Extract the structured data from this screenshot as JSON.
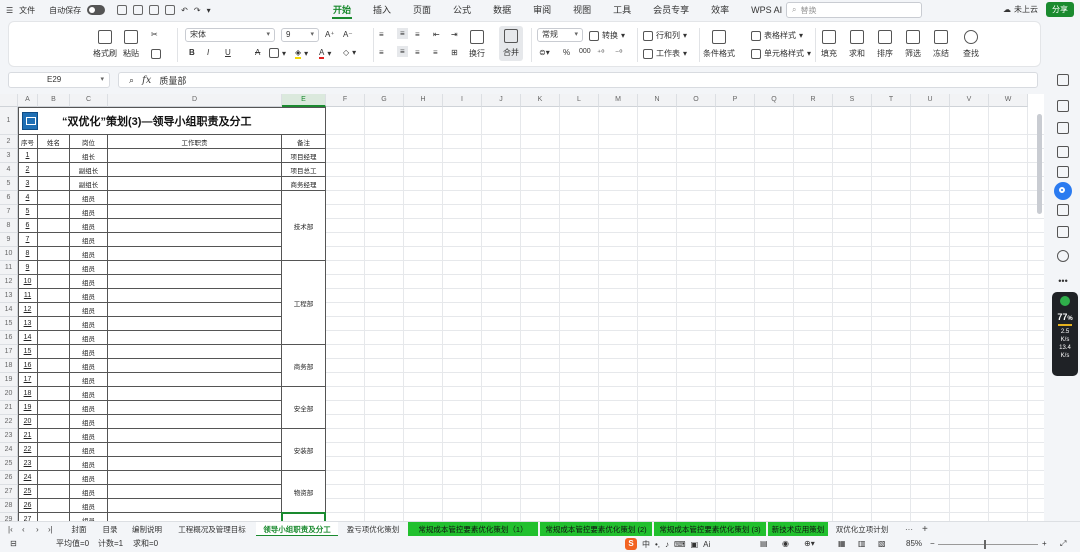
{
  "menubar": {
    "file": "文件",
    "autosave": "自动保存",
    "tabs": [
      "开始",
      "插入",
      "页面",
      "公式",
      "数据",
      "审阅",
      "视图",
      "工具",
      "会员专享",
      "效率",
      "WPS AI"
    ],
    "active_tab": "开始",
    "search_placeholder": "替换",
    "cloud": "未上云",
    "share": "分享"
  },
  "ribbon": {
    "format_painter": "格式刷",
    "paste": "粘贴",
    "font_name": "宋体",
    "font_size": "9",
    "bold": "B",
    "italic": "I",
    "underline": "U",
    "strike": "A",
    "wrap": "换行",
    "merge": "合并",
    "number_format": "常规",
    "convert": "转换",
    "rows_cols": "行和列",
    "worksheet": "工作表",
    "cond_format": "条件格式",
    "table_style": "表格样式",
    "cell_style": "单元格样式",
    "fill": "填充",
    "sum": "求和",
    "sort": "排序",
    "filter": "筛选",
    "freeze": "冻结",
    "find": "查找",
    "percent": "%",
    "thousand": "000"
  },
  "formula_bar": {
    "cell_ref": "E29",
    "fx": "fx",
    "content": "质量部"
  },
  "sheet": {
    "columns": [
      "A",
      "B",
      "C",
      "D",
      "E",
      "F",
      "G",
      "H",
      "I",
      "J",
      "K",
      "L",
      "M",
      "N",
      "O",
      "P",
      "Q",
      "R",
      "S",
      "T",
      "U",
      "V",
      "W"
    ],
    "title": "“双优化”策划(3)—领导小组职责及分工",
    "headers": [
      "序号",
      "姓名",
      "岗位",
      "工作职责",
      "备注"
    ],
    "rows": [
      {
        "r": "3",
        "idx": "1",
        "role": "组长",
        "note": "项目经理"
      },
      {
        "r": "4",
        "idx": "2",
        "role": "副组长",
        "note": "项目总工"
      },
      {
        "r": "5",
        "idx": "3",
        "role": "副组长",
        "note": "商务经理"
      },
      {
        "r": "6",
        "idx": "4",
        "role": "组员",
        "note": ""
      },
      {
        "r": "7",
        "idx": "5",
        "role": "组员",
        "note": ""
      },
      {
        "r": "8",
        "idx": "6",
        "role": "组员",
        "note": ""
      },
      {
        "r": "9",
        "idx": "7",
        "role": "组员",
        "note": ""
      },
      {
        "r": "10",
        "idx": "8",
        "role": "组员",
        "note": ""
      },
      {
        "r": "11",
        "idx": "9",
        "role": "组员",
        "note": ""
      },
      {
        "r": "12",
        "idx": "10",
        "role": "组员",
        "note": ""
      },
      {
        "r": "13",
        "idx": "11",
        "role": "组员",
        "note": ""
      },
      {
        "r": "14",
        "idx": "12",
        "role": "组员",
        "note": ""
      },
      {
        "r": "15",
        "idx": "13",
        "role": "组员",
        "note": ""
      },
      {
        "r": "16",
        "idx": "14",
        "role": "组员",
        "note": ""
      },
      {
        "r": "17",
        "idx": "15",
        "role": "组员",
        "note": ""
      },
      {
        "r": "18",
        "idx": "16",
        "role": "组员",
        "note": ""
      },
      {
        "r": "19",
        "idx": "17",
        "role": "组员",
        "note": ""
      },
      {
        "r": "20",
        "idx": "18",
        "role": "组员",
        "note": ""
      },
      {
        "r": "21",
        "idx": "19",
        "role": "组员",
        "note": ""
      },
      {
        "r": "22",
        "idx": "20",
        "role": "组员",
        "note": ""
      },
      {
        "r": "23",
        "idx": "21",
        "role": "组员",
        "note": ""
      },
      {
        "r": "24",
        "idx": "22",
        "role": "组员",
        "note": ""
      },
      {
        "r": "25",
        "idx": "23",
        "role": "组员",
        "note": ""
      },
      {
        "r": "26",
        "idx": "24",
        "role": "组员",
        "note": ""
      },
      {
        "r": "27",
        "idx": "25",
        "role": "组员",
        "note": ""
      },
      {
        "r": "28",
        "idx": "26",
        "role": "组员",
        "note": ""
      },
      {
        "r": "29",
        "idx": "27",
        "role": "组员",
        "note": ""
      }
    ],
    "departments": [
      {
        "name": "技术部",
        "first": 3,
        "count": 5
      },
      {
        "name": "工程部",
        "first": 8,
        "count": 6
      },
      {
        "name": "商务部",
        "first": 14,
        "count": 3
      },
      {
        "name": "安全部",
        "first": 17,
        "count": 3
      },
      {
        "name": "安装部",
        "first": 20,
        "count": 3
      },
      {
        "name": "物资部",
        "first": 23,
        "count": 3
      }
    ]
  },
  "sheet_tabs": {
    "tabs": [
      {
        "label": "封面",
        "style": "normal"
      },
      {
        "label": "目录",
        "style": "normal"
      },
      {
        "label": "编制说明",
        "style": "normal"
      },
      {
        "label": "工程概况及管理目标",
        "style": "normal"
      },
      {
        "label": "领导小组职责及分工",
        "style": "active"
      },
      {
        "label": "盈亏项优化策划",
        "style": "normal"
      },
      {
        "label": "常规成本管控要素优化策划（1）",
        "style": "green"
      },
      {
        "label": "常规成本管控要素优化策划 (2)",
        "style": "green"
      },
      {
        "label": "常规成本管控要素优化策划 (3)",
        "style": "green"
      },
      {
        "label": "新技术应用策划",
        "style": "green"
      },
      {
        "label": "双优化立项计划",
        "style": "normal"
      }
    ],
    "more": "···",
    "add": "+"
  },
  "statusbar": {
    "average": "平均值=0",
    "count": "计数=1",
    "sum": "求和=0",
    "zoom": "85%",
    "ime_text": "中"
  },
  "perf": {
    "percent": "77",
    "up": "2.5",
    "down": "13.4",
    "unit": "K/s"
  }
}
